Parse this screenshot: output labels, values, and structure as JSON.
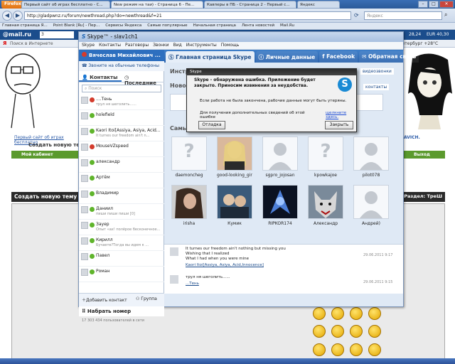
{
  "browser": {
    "menu_button": "Firefox",
    "tabs": [
      {
        "title": "Первый сайт об играх бесплатно - С..."
      },
      {
        "title": "New режим на таи) - Страница 6 - Пе..."
      },
      {
        "title": "Кавперы в ПБ - Страница 2 - Первый с..."
      },
      {
        "title": "Яндекс"
      }
    ],
    "url": "http://gladpwnz.ru/forum/newthread.php?do=newthread&f=21",
    "search_placeholder": "Яндекс",
    "bookmarks": [
      "Главная страница Я...",
      "Point Blank [Ru] - Пер...",
      "Сервисы Яндекса",
      "Самые популярные",
      "Начальная страница",
      "Лента новостей",
      "Mail.Ru"
    ],
    "mailru_logo": "@mail.ru",
    "mailru_search": "Поиск в Интернете",
    "mailru_weather": "+28°C",
    "mailru_rate": "28,24",
    "mailru_eur": "EUR 40,30",
    "yandex_search": "Поиск в Интернете",
    "yandex_weather": "Санкт-Петербург +28°C",
    "yandex_count": "3"
  },
  "forum": {
    "site_link": "Первый сайт об играх бесплатно",
    "create_topic_title": "Создать новую тему",
    "my_cabinet": "Мой кабинет",
    "exit": "Выход",
    "section_label": "Создать новую тему",
    "section_right": "Раздел: ТреШ",
    "banner_right": "AVICH."
  },
  "skype": {
    "title": "Skype™ - slav1ch1",
    "menu": [
      "Skype",
      "Контакты",
      "Разговоры",
      "Звонки",
      "Вид",
      "Инструменты",
      "Помощь"
    ],
    "profile_name": "Вячеслав Михайлович ...",
    "call_phones": "Звоните на обычные телефоны",
    "tabs": [
      "Контакты",
      "Последние"
    ],
    "search_placeholder": "Поиск",
    "contacts": [
      {
        "name": "....Тень",
        "mood": "трул ня шеголить......",
        "status": "red"
      },
      {
        "name": "holefield",
        "mood": "",
        "status": "green"
      },
      {
        "name": "Kaori Itoi[Assiya, Asiya, Acid...",
        "mood": "It turnes our freedom ain't n...",
        "status": "green"
      },
      {
        "name": "MouseVZspeed",
        "mood": "",
        "status": "red"
      },
      {
        "name": "александр",
        "mood": "",
        "status": "green"
      },
      {
        "name": "Артём",
        "mood": "",
        "status": "green"
      },
      {
        "name": "Владимир",
        "mood": "",
        "status": "green"
      },
      {
        "name": "Даниил",
        "mood": "пиши пиши пиши [0]",
        "status": "green"
      },
      {
        "name": "Зауер",
        "mood": "Опыт «ах! полёрое бесконечное...",
        "status": "green"
      },
      {
        "name": "Кирилл",
        "mood": "Бучаете?Тогда вы идем к ...",
        "status": "green"
      },
      {
        "name": "Павел",
        "mood": "",
        "status": "green"
      },
      {
        "name": "Роман",
        "mood": "",
        "status": "green"
      }
    ],
    "add_contact": "Добавить контакт",
    "group": "Группа",
    "dial_number": "Набрать номер",
    "users_online": "17 303 434 пользователей в сети",
    "main_tabs": [
      "Главная страница Skype",
      "Личные данные",
      "Facebook",
      "Обратная связь"
    ],
    "instr_label": "Инстр",
    "news_label": "Ново",
    "video_link": "видеозвонки",
    "contacts_link": "контакты",
    "popular_label": "Самы",
    "people_row1": [
      "daemoncheg",
      "good-looking_girl",
      "sgpro_jojosan",
      "kpowkajoe",
      "pilot078"
    ],
    "people_row2": [
      "irisha",
      "Кумик",
      "RIPKOR174",
      "Александр",
      "Андрей)"
    ],
    "feed": [
      {
        "text1": "It turnes our freedom ain't nothing but missing you",
        "text2": "Wishing that I realized",
        "text3": "What I had when you were mine",
        "author": "Kaori Itoi[Assiya, Asiya, Acid,Innocence]",
        "date": "29.06.2011 9:17"
      },
      {
        "text1": "трул ня шеголить......",
        "text2": "",
        "text3": "",
        "author": "...Тень",
        "date": "29.06.2011 9:15"
      }
    ]
  },
  "error": {
    "title": "Skype",
    "heading": "Skype - обнаружена ошибка. Приложение будет закрыто. Приносим извинения за неудобства.",
    "body": "Если работа не была закончена, рабочие данные могут быть утеряны.",
    "more_info": "Для получения дополнительных сведений об этой ошибке",
    "click_here": "щелкните здесь.",
    "debug_button": "Отладка",
    "close_button": "Закрыть"
  },
  "colors": {
    "skype_blue": "#2d6fbf",
    "status_online": "#5fb42b",
    "status_busy": "#d33b2c"
  }
}
